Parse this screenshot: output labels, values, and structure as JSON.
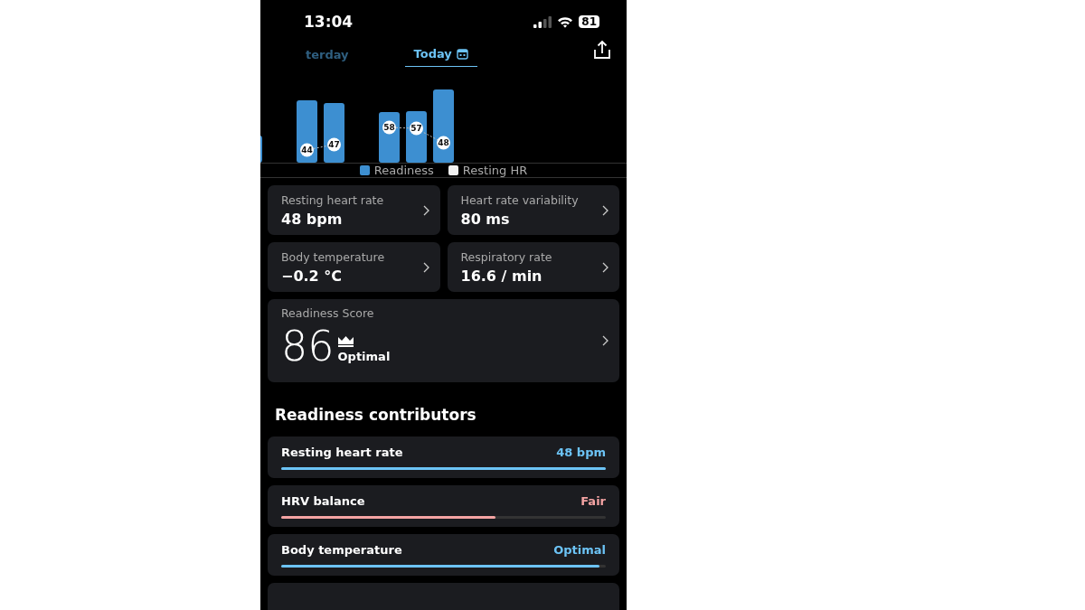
{
  "status_bar": {
    "time": "13:04",
    "battery": "81"
  },
  "tabs": [
    {
      "label": "terday",
      "selected": false
    },
    {
      "label": "Today",
      "selected": true
    }
  ],
  "chart": {
    "resting_hr_labels": [
      "44",
      "47",
      "58",
      "57",
      "48"
    ]
  },
  "legend": [
    {
      "label": "Readiness",
      "color": "#3d8fd1"
    },
    {
      "label": "Resting HR",
      "color": "#f2f2f2"
    }
  ],
  "metrics": [
    {
      "label": "Resting heart rate",
      "value": "48 bpm"
    },
    {
      "label": "Heart rate variability",
      "value": "80 ms"
    },
    {
      "label": "Body temperature",
      "value": "−0.2 °C"
    },
    {
      "label": "Respiratory rate",
      "value": "16.6 / min"
    }
  ],
  "score": {
    "label": "Readiness Score",
    "value": "86",
    "rating": "Optimal"
  },
  "contributors_title": "Readiness contributors",
  "contributors": [
    {
      "name": "Resting heart rate",
      "value": "48 bpm",
      "color": "#6cc3f5",
      "level": 1.0
    },
    {
      "name": "HRV balance",
      "value": "Fair",
      "color": "#f4a3a3",
      "level": 0.66
    },
    {
      "name": "Body temperature",
      "value": "Optimal",
      "color": "#6cc3f5",
      "level": 0.98
    }
  ]
}
